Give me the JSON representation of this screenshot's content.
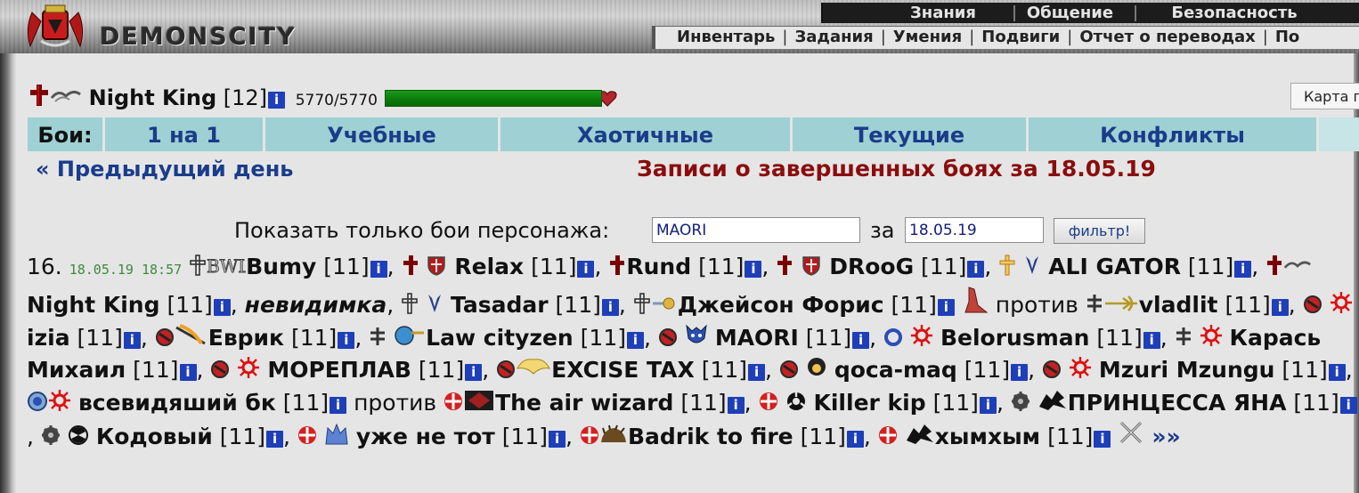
{
  "app": {
    "logo_text": "DEMONSCITY"
  },
  "top_nav": {
    "items": [
      "Знания",
      "Общение",
      "Безопасность"
    ]
  },
  "sub_nav": {
    "items": [
      "Инвентарь",
      "Задания",
      "Умения",
      "Подвиги",
      "Отчет о переводах",
      "По"
    ]
  },
  "player": {
    "name": "Night King",
    "level": "[12]",
    "hp_text": "5770/5770",
    "hp_fraction": 1.0,
    "info_glyph": "i"
  },
  "map_button": {
    "label": "Карта г"
  },
  "tabs": {
    "label": "Бои:",
    "items": [
      "1 на 1",
      "Учебные",
      "Хаотичные",
      "Текущие",
      "Конфликты"
    ]
  },
  "day_nav": {
    "prev": "« Предыдущий день",
    "title": "Записи о завершенных боях за 18.05.19"
  },
  "filter": {
    "label": "Показать только бои персонажа:",
    "name_value": "MAORI",
    "za": "за",
    "date_value": "18.05.19",
    "button": "фильтр!"
  },
  "record": {
    "num": "16.",
    "timestamp": "18.05.19 18:57",
    "vs": "против",
    "more": "»»",
    "level": "[11]",
    "team1": [
      "Bumy",
      "Relax",
      "Rund",
      "DRooG",
      "ALI GATOR",
      "Night King",
      "невидимка",
      "Tasadar",
      "Джейсон Форис"
    ],
    "team2": [
      "vladlit",
      "izia",
      "Еврик",
      "Law cityzen",
      "MAORI",
      "Belorusman",
      "Карась Михаил",
      "МОРЕПЛАВ",
      "EXCISE TAX",
      "qoca-maq",
      "Mzuri Mzungu",
      "всевидяший бк"
    ],
    "team3": [
      "The air wizard",
      "Killer kip",
      "ПРИНЦЕССА ЯНА",
      "Кодовый",
      "уже не тот",
      "Badrik to fire",
      "хымхым"
    ]
  },
  "colors": {
    "tab_bg": "#9fd0d3",
    "tab_text": "#1a3c8a",
    "title_red": "#8a0d0d",
    "hp_green": "#0a7a0a",
    "info_blue": "#1e3fb8",
    "timestamp_green": "#3d8a3d"
  }
}
